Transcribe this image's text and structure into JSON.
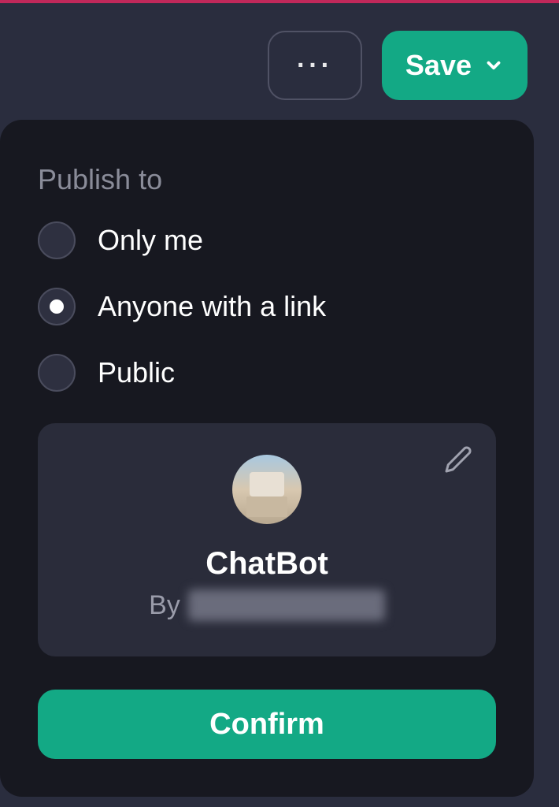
{
  "toolbar": {
    "more_label": "···",
    "save_label": "Save"
  },
  "popup": {
    "title": "Publish to",
    "options": [
      {
        "label": "Only me",
        "selected": false
      },
      {
        "label": "Anyone with a link",
        "selected": true
      },
      {
        "label": "Public",
        "selected": false
      }
    ],
    "preview": {
      "name": "ChatBot",
      "by_prefix": "By"
    },
    "confirm_label": "Confirm"
  },
  "colors": {
    "accent": "#13a985",
    "bg_main": "#2a2d3e",
    "bg_popup": "#171820",
    "bg_card": "#2a2c3a",
    "top_border": "#c0285a"
  }
}
